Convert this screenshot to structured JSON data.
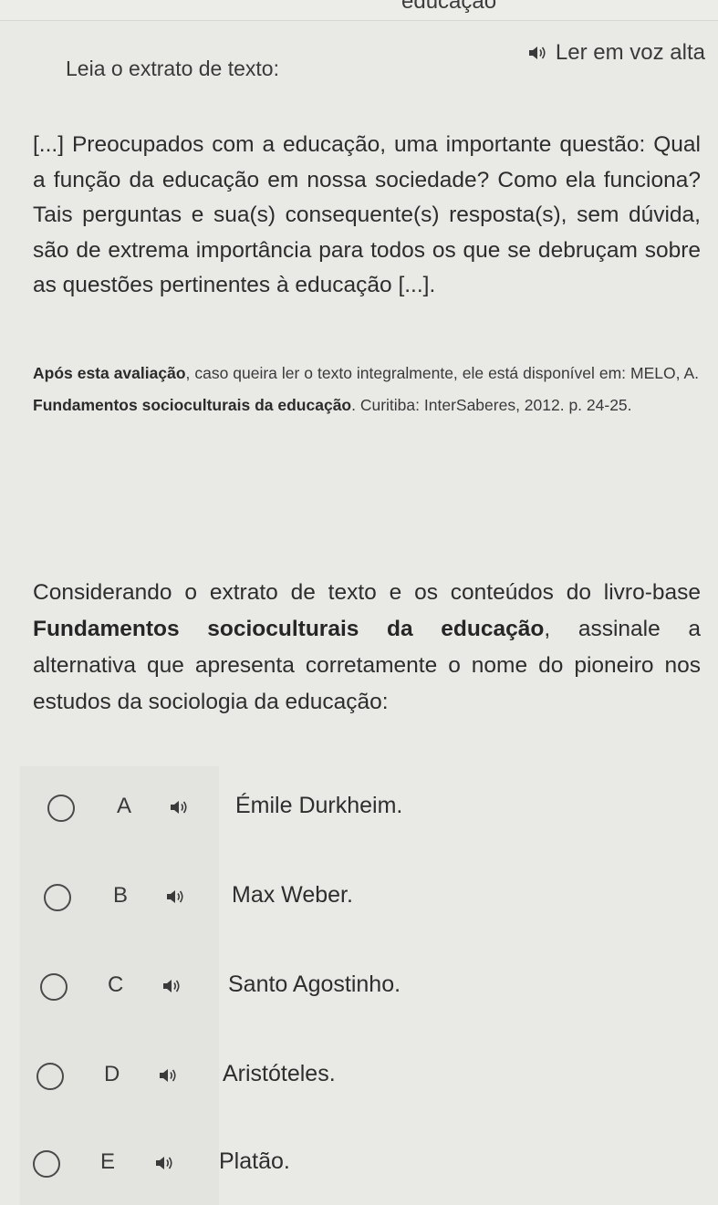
{
  "header": {
    "partial_title": "educação",
    "read_aloud_label": "Ler em voz alta"
  },
  "instruction": "Leia o extrato de texto:",
  "excerpt": "[...] Preocupados com a educação, uma importante questão: Qual a função da educação em nossa sociedade? Como ela funciona? Tais perguntas e sua(s) consequente(s) resposta(s), sem dúvida, são de extrema importância para todos os que se debruçam sobre as questões pertinentes à educação [...].",
  "source": {
    "bold_lead": "Após esta avaliação",
    "text_1": ", caso queira ler o texto integralmente, ele está disponível em: MELO, A. ",
    "book_title": "Fundamentos socioculturais da educação",
    "text_2": ". Curitiba: InterSaberes, 2012. p. 24-25."
  },
  "question": {
    "text_1": "Considerando o extrato de texto e os conteúdos do livro-base ",
    "book_title": "Fundamentos socioculturais da educação",
    "text_2": ", assinale a alternativa que apresenta corretamente o nome do pioneiro nos estudos da sociologia da educação:"
  },
  "options": [
    {
      "letter": "A",
      "text": "Émile Durkheim."
    },
    {
      "letter": "B",
      "text": "Max Weber."
    },
    {
      "letter": "C",
      "text": "Santo Agostinho."
    },
    {
      "letter": "D",
      "text": "Aristóteles."
    },
    {
      "letter": "E",
      "text": "Platão."
    }
  ],
  "icons": {
    "speaker": "speaker-icon",
    "radio": "radio-empty"
  }
}
